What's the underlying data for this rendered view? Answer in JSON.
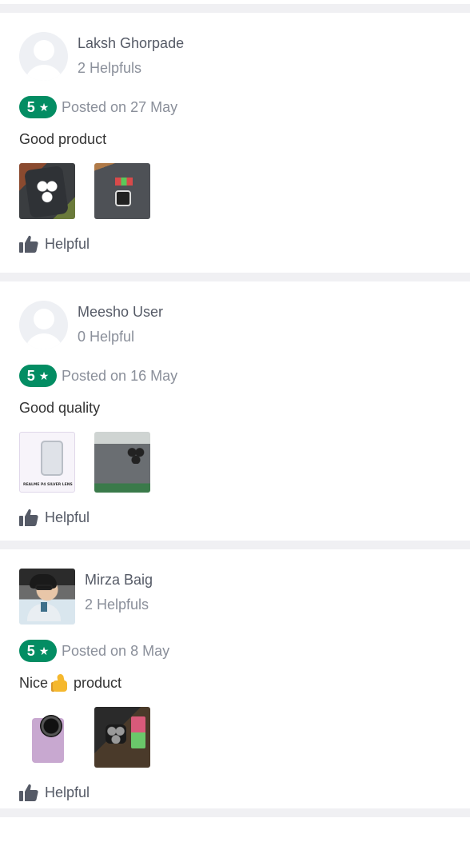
{
  "reviews": [
    {
      "user_name": "Laksh Ghorpade",
      "helpful_count": "2 Helpfuls",
      "rating": "5",
      "posted": "Posted on 27 May",
      "comment_before": "Good product",
      "comment_emoji": "",
      "comment_after": "",
      "helpful_label": "Helpful",
      "avatar": "default-avatar-icon"
    },
    {
      "user_name": "Meesho User",
      "helpful_count": "0 Helpful",
      "rating": "5",
      "posted": "Posted on 16 May",
      "comment_before": "Good quality",
      "comment_emoji": "",
      "comment_after": "",
      "helpful_label": "Helpful",
      "avatar": "default-avatar-icon"
    },
    {
      "user_name": "Mirza Baig",
      "helpful_count": "2 Helpfuls",
      "rating": "5",
      "posted": "Posted on 8 May",
      "comment_before": "Nice",
      "comment_emoji": "thumbs-up-emoji",
      "comment_after": "product",
      "helpful_label": "Helpful",
      "avatar": "user-photo"
    }
  ],
  "colors": {
    "rating_badge": "#038d63",
    "divider": "#f0f0f3",
    "muted_text": "#8a8f9a"
  },
  "icons": {
    "rating_star": "star-icon",
    "helpful": "thumbs-up-icon"
  }
}
